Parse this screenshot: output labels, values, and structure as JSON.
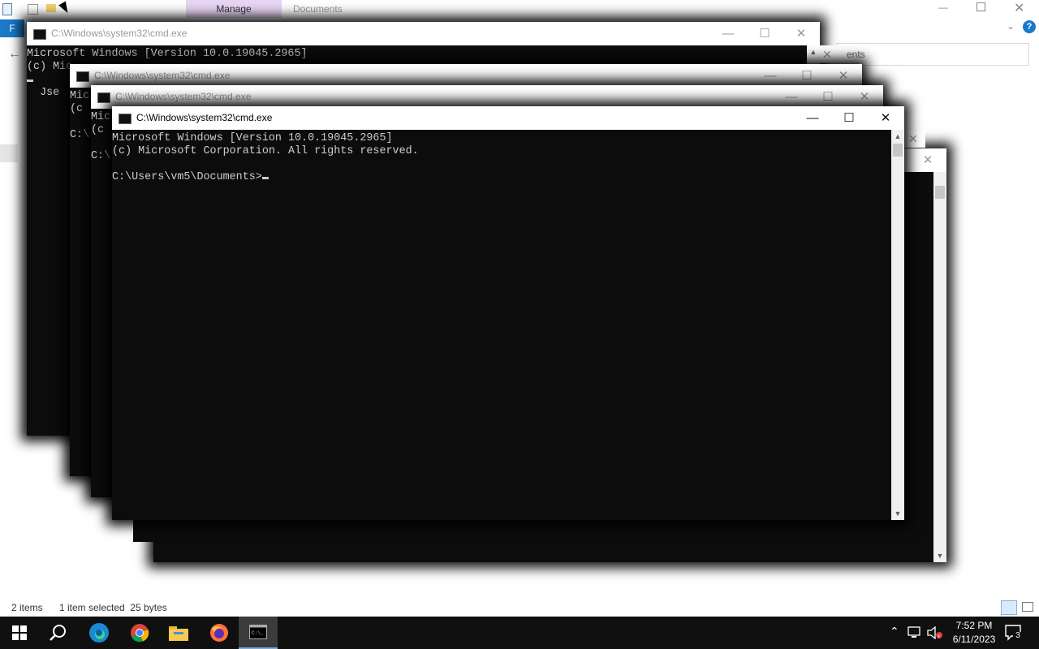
{
  "explorer": {
    "manage_tab": "Manage",
    "window_title": "Documents",
    "file_tab": "F",
    "address_suffix": "ents",
    "status_items": "2 items",
    "status_selected": "1 item selected  25 bytes"
  },
  "cmd_windows": [
    {
      "title": "C:\\Windows\\system32\\cmd.exe",
      "line1": "Microsoft Windows [Version 10.0.19045.2965]",
      "line2": "(c) Mic",
      "line3": "  Jse"
    },
    {
      "title": "C:\\Windows\\system32\\cmd.exe",
      "line1": "Mic",
      "line2": "(c",
      "line3": "C:\\"
    },
    {
      "title": "C:\\Windows\\system32\\cmd.exe",
      "line1": "Mic",
      "line2": "(c",
      "line3": "C:\\"
    },
    {
      "title": "C:\\Windows\\system32\\cmd.exe",
      "line1": "Microsoft Windows [Version 10.0.19045.2965]",
      "line2": "(c) Microsoft Corporation. All rights reserved.",
      "prompt": "C:\\Users\\vm5\\Documents>"
    }
  ],
  "taskbar": {
    "time": "7:52 PM",
    "date": "6/11/2023",
    "notification_count": "3",
    "apps": [
      "start-icon",
      "search-icon",
      "edge-icon",
      "chrome-icon",
      "file-explorer-icon",
      "firefox-icon",
      "cmd-icon"
    ]
  },
  "colors": {
    "console_bg": "#0c0c0c",
    "console_text": "#cccccc",
    "manage_tab_bg": "#e9d5f5",
    "file_tab_bg": "#1979ca",
    "taskbar_bg": "#101010"
  }
}
